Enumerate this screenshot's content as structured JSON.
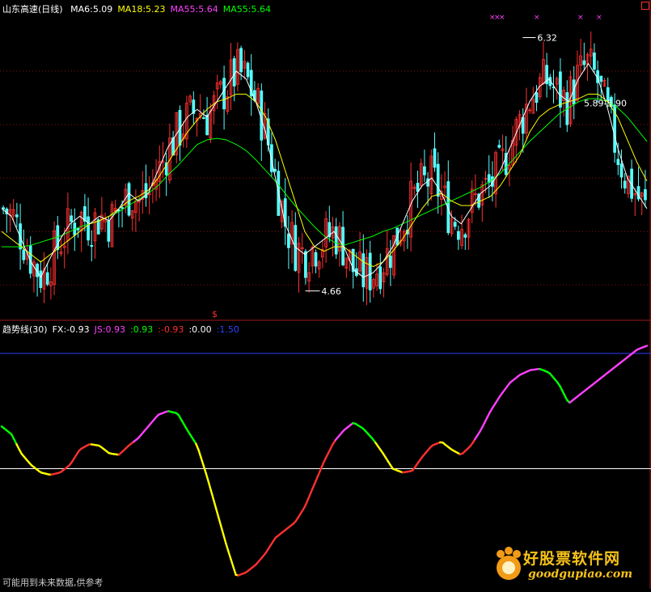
{
  "header": {
    "stock_name": "山东高速(日线)",
    "ma_labels": [
      {
        "text": "MA6:5.09",
        "color": "#ffffff"
      },
      {
        "text": "MA18:5.23",
        "color": "#ffff00"
      },
      {
        "text": "MA55:5.64",
        "color": "#ff40ff"
      },
      {
        "text": "MA55:5.64",
        "color": "#00ff00"
      }
    ]
  },
  "indicator": {
    "labels": [
      {
        "text": "趋势线(30)",
        "color": "#ffffff"
      },
      {
        "text": "FX:-0.93",
        "color": "#ffffff"
      },
      {
        "text": "JS:0.93",
        "color": "#ff40ff"
      },
      {
        "text": ":0.93",
        "color": "#00ff00"
      },
      {
        "text": ":-0.93",
        "color": "#ff3030"
      },
      {
        "text": ":0.00",
        "color": "#ffffff"
      },
      {
        "text": ":1.50",
        "color": "#3040ff"
      }
    ]
  },
  "price_annotations": {
    "high": "6.32",
    "low": "4.66",
    "range": "5.89-5.90",
    "signal_marker": "$"
  },
  "footer": "可能用到未来数据,供参考",
  "watermark": {
    "cn": "好股票软件网",
    "en": "goodgupiao.com"
  },
  "chart_data": [
    {
      "type": "candlestick",
      "title": "山东高速(日线)",
      "ylim": [
        4.5,
        6.45
      ],
      "y_labels_printed": [
        "6.32",
        "4.66",
        "5.89-5.90"
      ],
      "grid": "dotted horizontal",
      "colors": {
        "up": "#ff3030",
        "down": "#54ffff",
        "ma6": "#ffffff",
        "ma18": "#ffff00",
        "ma55": "#00ff00"
      },
      "ma6_path": [
        5.2,
        5.15,
        5.0,
        4.85,
        4.75,
        4.88,
        5.0,
        5.1,
        5.15,
        5.1,
        5.15,
        5.12,
        5.2,
        5.3,
        5.25,
        5.3,
        5.45,
        5.6,
        5.7,
        5.8,
        5.85,
        5.8,
        5.9,
        6.0,
        6.1,
        6.05,
        5.9,
        5.7,
        5.4,
        5.1,
        4.95,
        4.9,
        4.95,
        5.0,
        5.05,
        4.95,
        4.8,
        4.75,
        4.78,
        4.85,
        4.95,
        5.1,
        5.25,
        5.35,
        5.4,
        5.3,
        5.15,
        5.1,
        5.2,
        5.3,
        5.35,
        5.45,
        5.6,
        5.75,
        5.9,
        6.0,
        6.05,
        5.95,
        5.9,
        6.05,
        6.15,
        6.05,
        5.85,
        5.6,
        5.4,
        5.3,
        5.2
      ],
      "ma18_path": [
        5.05,
        5.0,
        4.95,
        4.9,
        4.85,
        4.9,
        4.95,
        5.0,
        5.05,
        5.1,
        5.12,
        5.15,
        5.2,
        5.25,
        5.28,
        5.32,
        5.4,
        5.5,
        5.6,
        5.7,
        5.78,
        5.85,
        5.9,
        5.92,
        5.95,
        5.95,
        5.9,
        5.8,
        5.65,
        5.45,
        5.25,
        5.05,
        4.95,
        4.92,
        4.95,
        4.95,
        4.9,
        4.85,
        4.82,
        4.85,
        4.92,
        5.0,
        5.1,
        5.2,
        5.28,
        5.3,
        5.25,
        5.22,
        5.22,
        5.25,
        5.28,
        5.35,
        5.45,
        5.55,
        5.7,
        5.8,
        5.85,
        5.88,
        5.9,
        5.92,
        5.95,
        5.95,
        5.9,
        5.8,
        5.65,
        5.5,
        5.38
      ],
      "ma55_path": [
        4.95,
        4.95,
        4.95,
        4.96,
        4.98,
        5.0,
        5.02,
        5.05,
        5.08,
        5.1,
        5.12,
        5.15,
        5.18,
        5.22,
        5.26,
        5.3,
        5.35,
        5.42,
        5.48,
        5.55,
        5.62,
        5.65,
        5.66,
        5.65,
        5.62,
        5.58,
        5.52,
        5.45,
        5.38,
        5.3,
        5.22,
        5.15,
        5.08,
        5.02,
        4.98,
        4.96,
        4.98,
        5.0,
        5.02,
        5.05,
        5.07,
        5.1,
        5.13,
        5.16,
        5.19,
        5.22,
        5.25,
        5.28,
        5.31,
        5.34,
        5.38,
        5.43,
        5.5,
        5.57,
        5.64,
        5.7,
        5.76,
        5.82,
        5.86,
        5.9,
        5.92,
        5.92,
        5.9,
        5.86,
        5.8,
        5.72,
        5.64
      ]
    },
    {
      "type": "line",
      "title": "趋势线(30)",
      "ylim": [
        -1.5,
        1.7
      ],
      "reference_lines": [
        {
          "value": 0.0,
          "color": "#ffffff"
        },
        {
          "value": 1.5,
          "color": "#3040ff"
        }
      ],
      "colors": {
        "rising": "#ff3030",
        "falling": "#ffff00",
        "high_rising": "#ff40ff",
        "high_falling": "#00ff00"
      },
      "trend_path": [
        0.55,
        0.45,
        0.2,
        0.05,
        -0.05,
        -0.08,
        -0.05,
        0.05,
        0.25,
        0.32,
        0.3,
        0.2,
        0.18,
        0.3,
        0.4,
        0.55,
        0.7,
        0.75,
        0.72,
        0.5,
        0.3,
        -0.1,
        -0.55,
        -1.0,
        -1.4,
        -1.35,
        -1.25,
        -1.1,
        -0.9,
        -0.8,
        -0.7,
        -0.5,
        -0.2,
        0.1,
        0.35,
        0.5,
        0.6,
        0.52,
        0.38,
        0.2,
        0.0,
        -0.05,
        -0.03,
        0.15,
        0.3,
        0.35,
        0.25,
        0.18,
        0.3,
        0.5,
        0.75,
        0.95,
        1.12,
        1.22,
        1.28,
        1.3,
        1.25,
        1.1,
        0.85,
        0.95,
        1.05,
        1.15,
        1.25,
        1.35,
        1.45,
        1.55,
        1.6
      ]
    }
  ]
}
